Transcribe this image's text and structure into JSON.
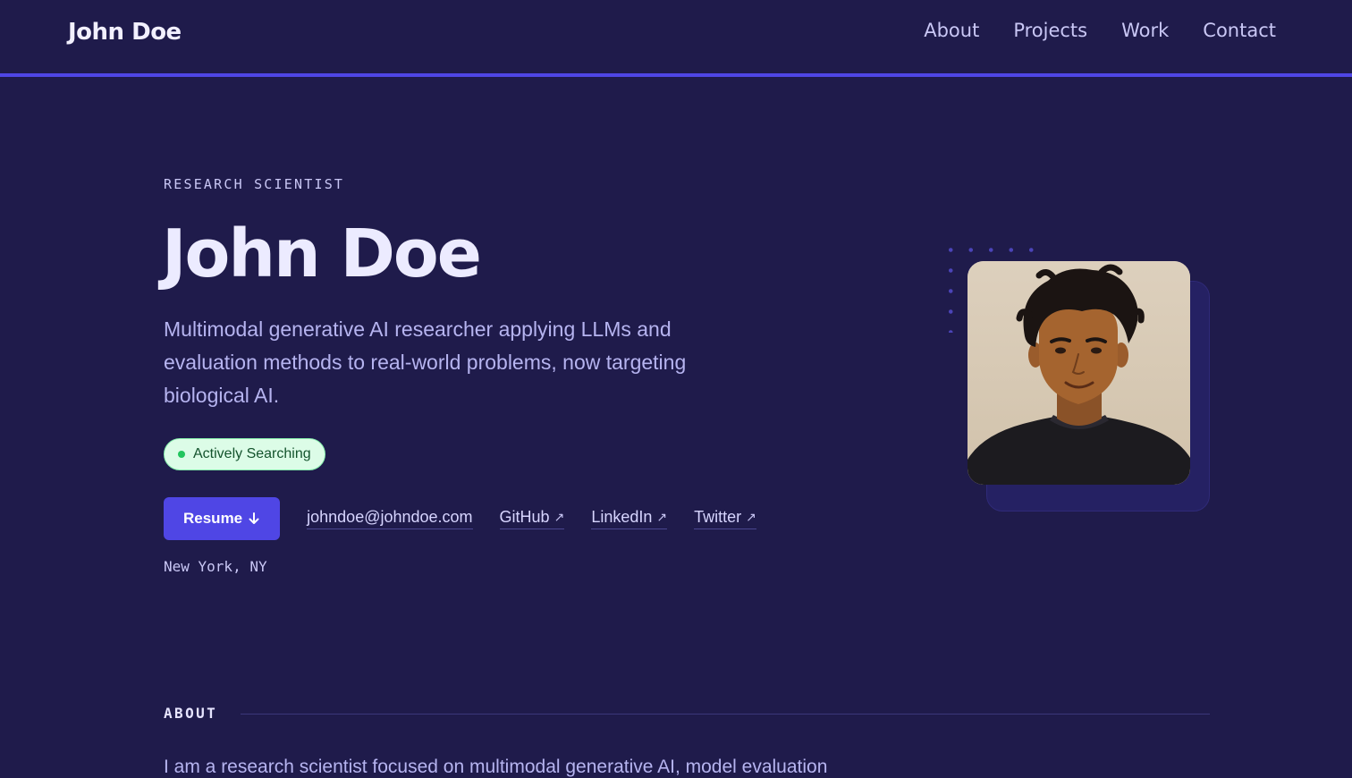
{
  "header": {
    "brand": "John Doe",
    "nav": [
      "About",
      "Projects",
      "Work",
      "Contact"
    ]
  },
  "hero": {
    "kicker": "RESEARCH SCIENTIST",
    "name": "John Doe",
    "tagline": "Multimodal generative AI researcher applying LLMs and evaluation methods to real-world problems, now targeting biological AI.",
    "status": "Actively Searching",
    "resume_label": "Resume",
    "resume_icon": "arrow-down-icon",
    "email": "johndoe@johndoe.com",
    "links": [
      {
        "label": "GitHub",
        "icon": "external-link-icon"
      },
      {
        "label": "LinkedIn",
        "icon": "external-link-icon"
      },
      {
        "label": "Twitter",
        "icon": "external-link-icon"
      }
    ],
    "location": "New York, NY"
  },
  "about": {
    "title": "ABOUT",
    "text": "I am a research scientist focused on multimodal generative AI, model evaluation"
  },
  "colors": {
    "background": "#1f1b4b",
    "accent": "#4f46e5",
    "status_bg": "#dcfce7",
    "status_dot": "#22c55e"
  }
}
